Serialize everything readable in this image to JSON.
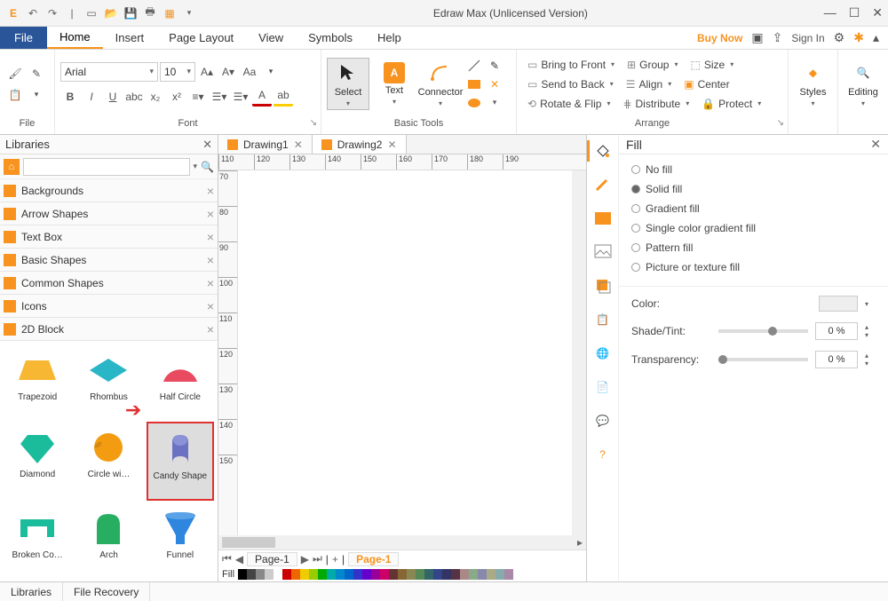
{
  "window": {
    "title": "Edraw Max (Unlicensed Version)"
  },
  "menubar": {
    "file": "File",
    "items": [
      "Home",
      "Insert",
      "Page Layout",
      "View",
      "Symbols",
      "Help"
    ],
    "active": "Home",
    "buy": "Buy Now",
    "signin": "Sign In"
  },
  "ribbon": {
    "groups": {
      "file": "File",
      "font": "Font",
      "basic_tools": "Basic Tools",
      "arrange": "Arrange"
    },
    "font": {
      "name": "Arial",
      "size": "10"
    },
    "tools": {
      "select": "Select",
      "text": "Text",
      "connector": "Connector"
    },
    "arrange": {
      "bring_front": "Bring to Front",
      "send_back": "Send to Back",
      "rotate": "Rotate & Flip",
      "group": "Group",
      "align": "Align",
      "distribute": "Distribute",
      "size": "Size",
      "center": "Center",
      "protect": "Protect"
    },
    "right": {
      "styles": "Styles",
      "editing": "Editing"
    }
  },
  "libraries": {
    "title": "Libraries",
    "search_placeholder": "",
    "categories": [
      "Backgrounds",
      "Arrow Shapes",
      "Text Box",
      "Basic Shapes",
      "Common Shapes",
      "Icons",
      "2D Block"
    ],
    "shapes": [
      "Trapezoid",
      "Rhombus",
      "Half Circle",
      "Diamond",
      "Circle wi…",
      "Candy Shape",
      "Broken Co…",
      "Arch",
      "Funnel"
    ],
    "highlighted": "Candy Shape"
  },
  "documents": {
    "tabs": [
      "Drawing1",
      "Drawing2"
    ],
    "active": "Drawing2"
  },
  "ruler_h": [
    "110",
    "120",
    "130",
    "140",
    "150",
    "160",
    "170",
    "180",
    "190"
  ],
  "ruler_v": [
    "70",
    "80",
    "90",
    "100",
    "110",
    "120",
    "130",
    "140",
    "150"
  ],
  "page": {
    "name": "Page-1",
    "active": "Page-1",
    "fill_label": "Fill"
  },
  "fill": {
    "title": "Fill",
    "options": [
      "No fill",
      "Solid fill",
      "Gradient fill",
      "Single color gradient fill",
      "Pattern fill",
      "Picture or texture fill"
    ],
    "selected": "Solid fill",
    "color_label": "Color:",
    "shade_label": "Shade/Tint:",
    "shade_value": "0 %",
    "transp_label": "Transparency:",
    "transp_value": "0 %"
  },
  "bottom_tabs": [
    "Libraries",
    "File Recovery"
  ],
  "colorbar_hues": [
    "#000",
    "#444",
    "#888",
    "#ccc",
    "#fff",
    "#c00",
    "#e60",
    "#ec0",
    "#9c0",
    "#0a0",
    "#0aa",
    "#08c",
    "#06c",
    "#33c",
    "#60c",
    "#909",
    "#c06",
    "#633",
    "#863",
    "#885",
    "#585",
    "#366",
    "#348",
    "#336",
    "#534",
    "#a88",
    "#8a8",
    "#88a",
    "#aa8",
    "#8aa",
    "#a8a"
  ]
}
